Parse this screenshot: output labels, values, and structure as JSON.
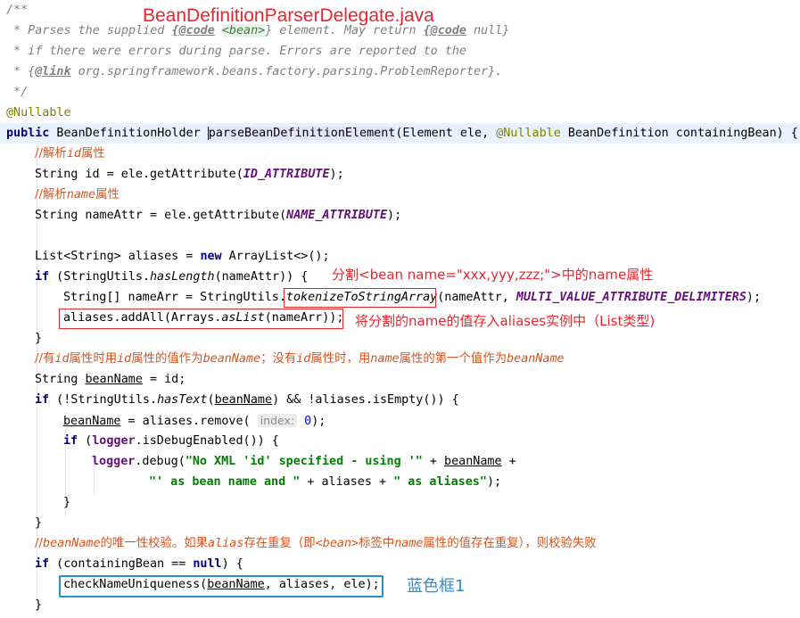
{
  "title": "BeanDefinitionParserDelegate.java",
  "annotations": {
    "split_note": "分割<bean name=\"xxx,yyy,zzz;\">中的name属性",
    "store_note": "将分割的name的值存入aliases实例中（List类型)",
    "blue_box_label": "蓝色框1"
  },
  "colors": {
    "annotation_red": "#e8262e",
    "annotation_blue": "#2d8ecf"
  },
  "code": {
    "l01": "/**",
    "l02a": " * Parses the supplied ",
    "l02b": "{@code",
    "l02c": " ",
    "l02d": "<bean>",
    "l02e": "} element. May return ",
    "l02f": "{@code",
    "l02g": " null}",
    "l03": " * if there were errors during parse. Errors are reported to the",
    "l04a": " * {",
    "l04b": "@link",
    "l04c": " org.springframework.beans.factory.parsing.ProblemReporter}.",
    "l05": " */",
    "l06": "@Nullable",
    "l07a": "public",
    "l07b": " BeanDefinitionHolder ",
    "l07c": "parseBeanDefinitionElement",
    "l07d": "(Element ele, ",
    "l07e": "@Nullable",
    "l07f": " BeanDefinition containingBean) {",
    "l08a": "//解析",
    "l08b": "id",
    "l08c": "属性",
    "l09a": "String id = ele.getAttribute(",
    "l09b": "ID_ATTRIBUTE",
    "l09c": ");",
    "l10a": "//解析",
    "l10b": "name",
    "l10c": "属性",
    "l11a": "String nameAttr = ele.getAttribute(",
    "l11b": "NAME_ATTRIBUTE",
    "l11c": ");",
    "l13a": "List<String> aliases = ",
    "l13b": "new",
    "l13c": " ArrayList<>();",
    "l14a": "if",
    "l14b": " (StringUtils.",
    "l14c": "hasLength",
    "l14d": "(nameAttr)) {",
    "l15a": "String[] nameArr = StringUtils.",
    "l15b": "tokenizeToStringArray",
    "l15c": "(nameAttr, ",
    "l15d": "MULTI_VALUE_ATTRIBUTE_DELIMITERS",
    "l15e": ");",
    "l16a": "aliases.addAll(Arrays.",
    "l16b": "asList",
    "l16c": "(nameArr));",
    "l17": "}",
    "l18a": "//有",
    "l18b": "id",
    "l18c": "属性时用",
    "l18d": "id",
    "l18e": "属性的值作为",
    "l18f": "beanName",
    "l18g": "；没有",
    "l18h": "id",
    "l18i": "属性时，用",
    "l18j": "name",
    "l18k": "属性的第一个值作为",
    "l18l": "beanName",
    "l19a": "String ",
    "l19b": "beanName",
    "l19c": " = id;",
    "l20a": "if",
    "l20b": " (!StringUtils.",
    "l20c": "hasText",
    "l20d": "(",
    "l20e": "beanName",
    "l20f": ") && !aliases.isEmpty()) {",
    "l21a": "beanName",
    "l21b": " = aliases.remove( ",
    "l21c": "index:",
    "l21d": " 0",
    "l21e": ");",
    "l22a": "if",
    "l22b": " (",
    "l22c": "logger",
    "l22d": ".isDebugEnabled()) {",
    "l23a": "logger",
    "l23b": ".debug(",
    "l23c": "\"No XML 'id' specified - using '\"",
    "l23d": " + ",
    "l23e": "beanName",
    "l23f": " +",
    "l24a": "\"' as bean name and \"",
    "l24b": " + aliases + ",
    "l24c": "\" as aliases\"",
    "l24d": ");",
    "l25": "}",
    "l26": "}",
    "l27a": "//",
    "l27b": "beanName",
    "l27c": "的唯一性校验。如果",
    "l27d": "alias",
    "l27e": "存在重复（即",
    "l27f": "<bean>",
    "l27g": "标签中",
    "l27h": "name",
    "l27i": "属性的值存在重复），则校验失败",
    "l28a": "if",
    "l28b": " (containingBean == ",
    "l28c": "null",
    "l28d": ") {",
    "l29a": "checkNameUniqueness(",
    "l29b": "beanName",
    "l29c": ", aliases, ele);",
    "l30": "}"
  }
}
